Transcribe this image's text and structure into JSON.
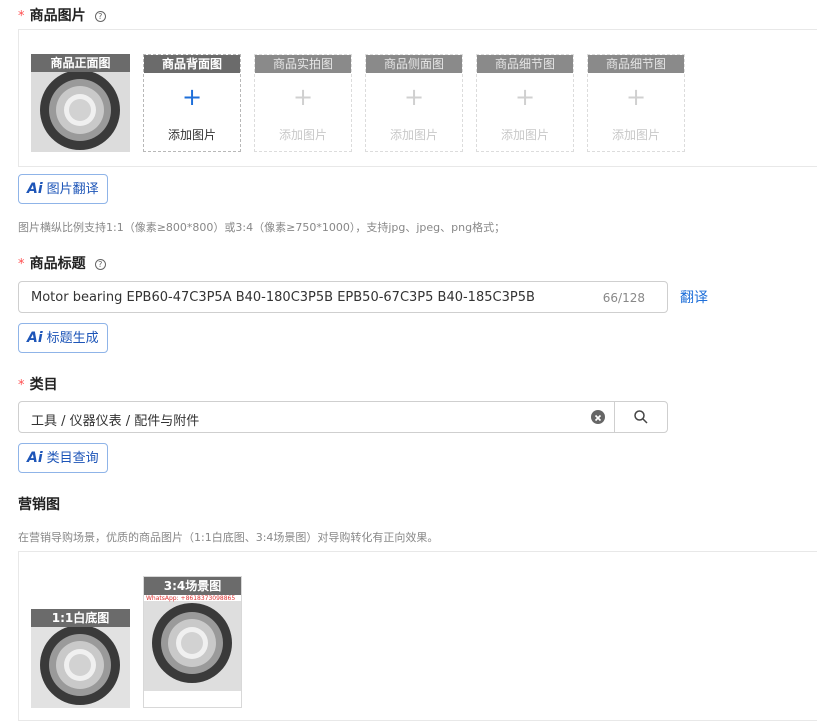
{
  "images_section": {
    "required_mark": "*",
    "title": "商品图片",
    "help": "?",
    "slots": [
      {
        "label": "商品正面图",
        "has_image": true
      },
      {
        "label": "商品背面图",
        "add_label": "添加图片",
        "plus": "+"
      },
      {
        "label": "商品实拍图",
        "add_label": "添加图片",
        "plus": "+"
      },
      {
        "label": "商品侧面图",
        "add_label": "添加图片",
        "plus": "+"
      },
      {
        "label": "商品细节图",
        "add_label": "添加图片",
        "plus": "+"
      },
      {
        "label": "商品细节图",
        "add_label": "添加图片",
        "plus": "+"
      }
    ],
    "ai_button": {
      "ai": "Ai",
      "label": "图片翻译"
    },
    "hint": "图片横纵比例支持1:1（像素≥800*800）或3:4（像素≥750*1000），支持jpg、jpeg、png格式；"
  },
  "title_section": {
    "required_mark": "*",
    "title": "商品标题",
    "help": "?",
    "value": "Motor bearing EPB60-47C3P5A B40-180C3P5B EPB50-67C3P5 B40-185C3P5B",
    "counter": "66/128",
    "translate_link": "翻译",
    "ai_button": {
      "ai": "Ai",
      "label": "标题生成"
    }
  },
  "category_section": {
    "required_mark": "*",
    "title": "类目",
    "value": "工具 / 仪器仪表 / 配件与附件",
    "ai_button": {
      "ai": "Ai",
      "label": "类目查询"
    }
  },
  "marketing_section": {
    "title": "营销图",
    "hint": "在营销导购场景，优质的商品图片（1:1白底图、3:4场景图）对导购转化有正向效果。",
    "slots": [
      {
        "label": "1:1白底图"
      },
      {
        "label": "3:4场景图",
        "watermark": "WhatsApp: +8618373098865"
      }
    ]
  },
  "colors": {
    "accent": "#1e6fd9",
    "required": "#ff4d4f",
    "ai_border": "#8fb4e8"
  }
}
